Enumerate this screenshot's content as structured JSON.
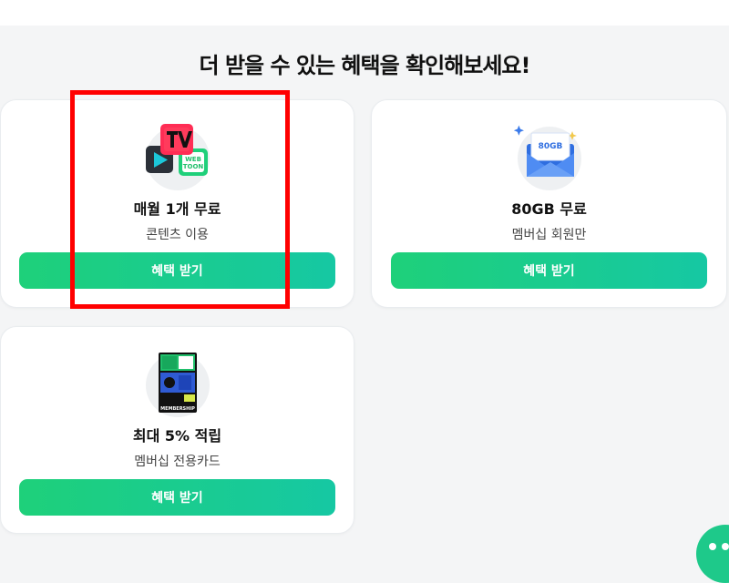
{
  "page": {
    "title": "더 받을 수 있는 혜택을 확인해보세요!"
  },
  "cards": [
    {
      "title": "매월 1개 무료",
      "subtitle": "콘텐츠 이용",
      "button_label": "혜택 받기",
      "icon": "naver-tv-webtoon-apps-icon",
      "icon_text": [
        "WEB",
        "TOON"
      ]
    },
    {
      "title": "80GB 무료",
      "subtitle": "멤버십 회원만",
      "button_label": "혜택 받기",
      "icon": "mail-envelope-storage-icon",
      "icon_text": "80GB"
    },
    {
      "title": "최대 5% 적립",
      "subtitle": "멤버십 전용카드",
      "button_label": "혜택 받기",
      "icon": "membership-card-icon",
      "icon_text": [
        "MEMBERSHIP"
      ]
    }
  ],
  "colors": {
    "accent_green": "#03c75a",
    "button_gradient_start": "#1ed07a",
    "button_gradient_end": "#16c8a3",
    "highlight_box": "#ff0000"
  }
}
